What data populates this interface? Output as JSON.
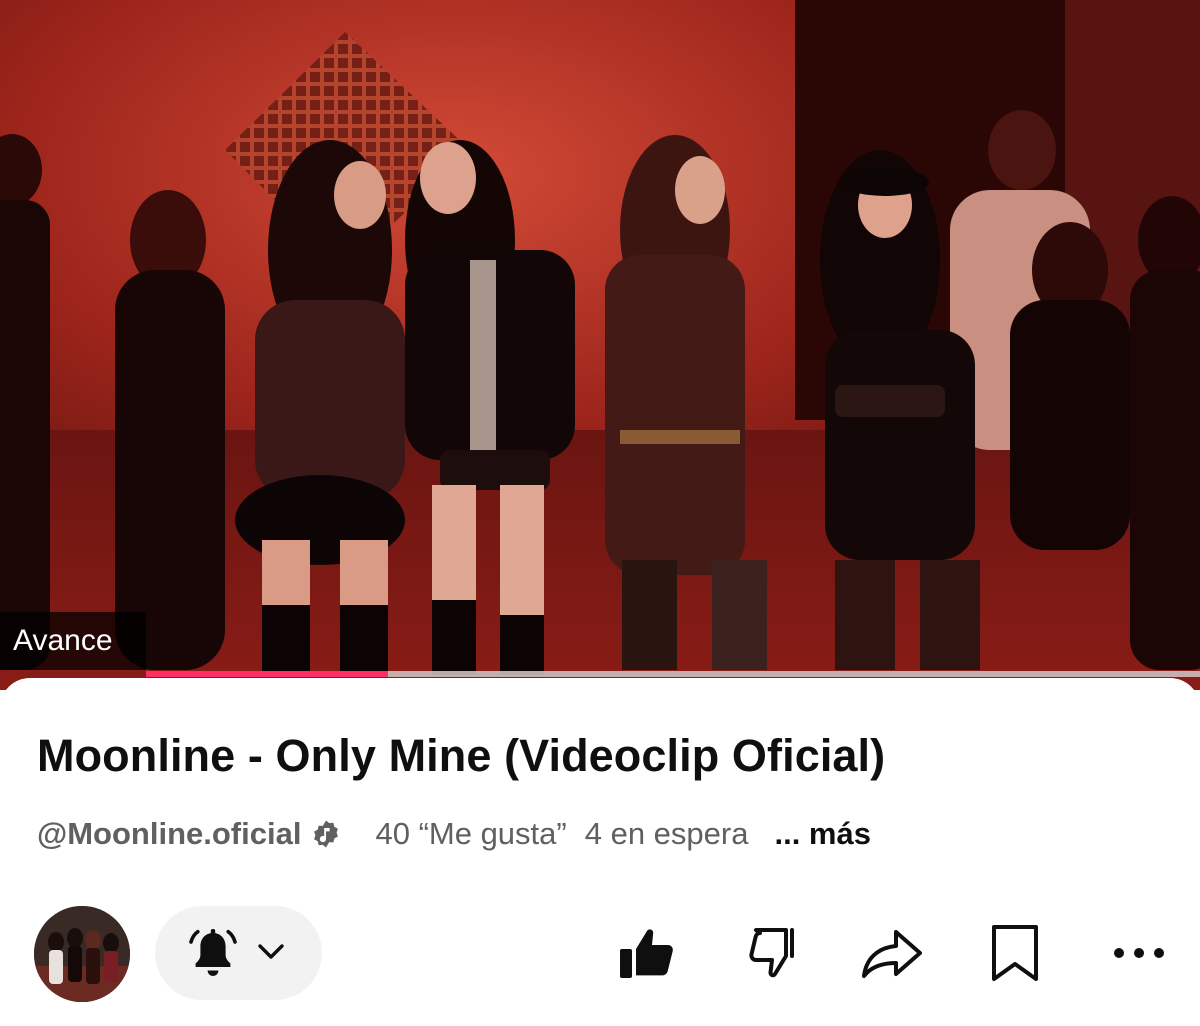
{
  "video": {
    "badge_label": "Avance",
    "progress": 0.23
  },
  "info": {
    "title": "Moonline - Only Mine (Videoclip Oficial)",
    "channel_handle": "@Moonline.oficial",
    "likes_text": "40 “Me gusta”",
    "queue_text": "4 en espera",
    "more_label": "... más"
  },
  "actions": {
    "icons": [
      "bell-icon",
      "chevron-down-icon",
      "thumbs-up-icon",
      "thumbs-down-icon",
      "share-icon",
      "bookmark-icon",
      "more-icon"
    ]
  },
  "colors": {
    "progress": "#ff2e63",
    "title": "#0f0f0f",
    "meta": "#606060",
    "pill": "#f2f2f2"
  }
}
